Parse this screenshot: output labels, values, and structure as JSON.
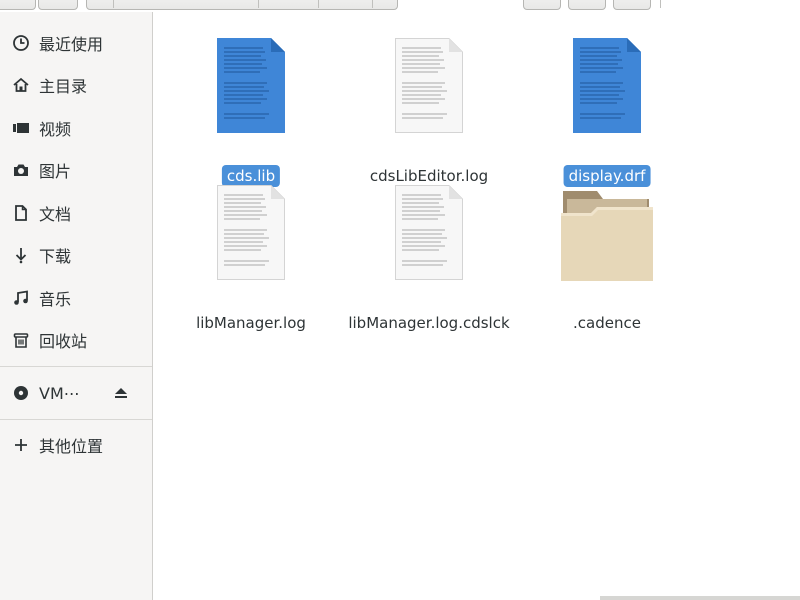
{
  "sidebar": {
    "items": [
      {
        "label": "最近使用",
        "icon": "clock-icon"
      },
      {
        "label": "主目录",
        "icon": "home-icon"
      },
      {
        "label": "视频",
        "icon": "video-icon"
      },
      {
        "label": "图片",
        "icon": "camera-icon"
      },
      {
        "label": "文档",
        "icon": "document-icon"
      },
      {
        "label": "下载",
        "icon": "download-icon"
      },
      {
        "label": "音乐",
        "icon": "music-icon"
      },
      {
        "label": "回收站",
        "icon": "trash-icon"
      }
    ],
    "device": {
      "label": "VM⋯",
      "icon": "disc-icon",
      "action_icon": "eject-icon"
    },
    "other": {
      "label": "其他位置",
      "icon": "plus-icon"
    }
  },
  "files": [
    {
      "name": "cds.lib",
      "type": "text-blue",
      "selected": true
    },
    {
      "name": "cdsLibEditor.log",
      "type": "text-white",
      "selected": false
    },
    {
      "name": "display.drf",
      "type": "text-blue",
      "selected": true
    },
    {
      "name": "libManager.log",
      "type": "text-white",
      "selected": false
    },
    {
      "name": "libManager.log.cdslck",
      "type": "text-white",
      "selected": false
    },
    {
      "name": ".cadence",
      "type": "folder",
      "selected": false
    }
  ],
  "colors": {
    "selection": "#4a90d9",
    "blue_doc": "#3f86d7",
    "folder": "#e4d5b5",
    "sidebar_bg": "#f6f5f4"
  }
}
